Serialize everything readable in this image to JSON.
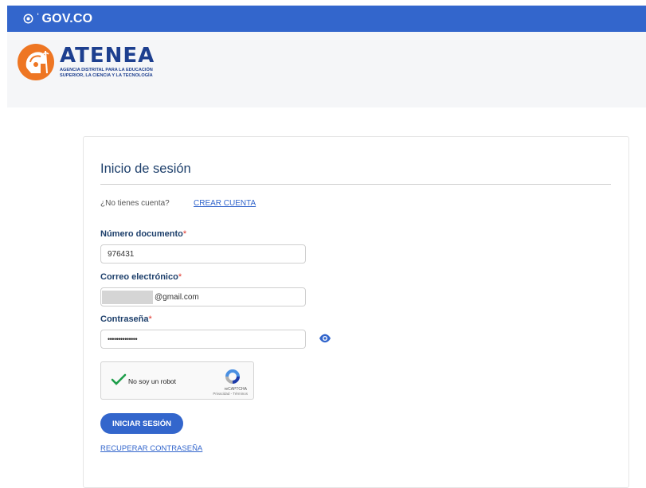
{
  "govbar": {
    "logo_text": "GOV.CO"
  },
  "brand": {
    "name": "ATENEA",
    "subtitle_line1": "Agencia Distrital para la Educación",
    "subtitle_line2": "Superior, la Ciencia y la Tecnología"
  },
  "login": {
    "title": "Inicio de sesión",
    "no_account_text": "¿No tienes cuenta?",
    "create_account_link": "CREAR CUENTA",
    "document_label": "Número documento",
    "document_value": "976431",
    "email_label": "Correo electrónico",
    "email_value": "@gmail.com",
    "password_label": "Contraseña",
    "password_value": "••••••••••••••",
    "required_mark": "*",
    "captcha_label": "No soy un robot",
    "captcha_brand": "reCAPTCHA",
    "captcha_terms": "Privacidad - Términos",
    "submit_button": "INICIAR SESIÓN",
    "recover_link": "RECUPERAR CONTRASEÑA"
  },
  "colors": {
    "gov_blue": "#3366cc",
    "title_navy": "#1d3f6b",
    "required_red": "#e0342b",
    "brand_orange": "#ee7623",
    "check_green": "#1e9e4a"
  }
}
